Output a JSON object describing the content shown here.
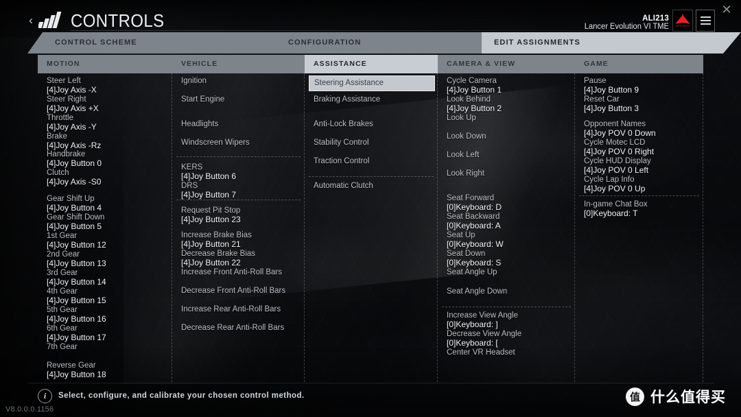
{
  "window": {
    "close_label": "✕"
  },
  "header": {
    "back_label": "‹",
    "title": "CONTROLS",
    "user_id": "ALI213",
    "user_car": "Lancer Evolution VI TME",
    "brand_text": "MITSUBISHI"
  },
  "tabs": [
    {
      "label": "CONTROL SCHEME",
      "selected": false
    },
    {
      "label": "CONFIGURATION",
      "selected": false
    },
    {
      "label": "EDIT ASSIGNMENTS",
      "selected": true
    }
  ],
  "columns": [
    {
      "header": "MOTION",
      "selected": false,
      "entries": [
        {
          "label": "Steer Left",
          "bind": "[4]Joy Axis -X"
        },
        {
          "label": "Steer Right",
          "bind": "[4]Joy Axis +X"
        },
        {
          "label": "Throttle",
          "bind": "[4]Joy Axis -Y"
        },
        {
          "label": "Brake",
          "bind": "[4]Joy Axis -Rz"
        },
        {
          "label": "Handbrake",
          "bind": "[4]Joy Button 0"
        },
        {
          "label": "Clutch",
          "bind": "[4]Joy Axis -S0"
        },
        {
          "label": "Gear Shift Up",
          "bind": "[4]Joy Button 4"
        },
        {
          "label": "Gear Shift Down",
          "bind": "[4]Joy Button 5"
        },
        {
          "label": "1st Gear",
          "bind": "[4]Joy Button 12"
        },
        {
          "label": "2nd Gear",
          "bind": "[4]Joy Button 13"
        },
        {
          "label": "3rd Gear",
          "bind": "[4]Joy Button 14"
        },
        {
          "label": "4th Gear",
          "bind": "[4]Joy Button 15"
        },
        {
          "label": "5th Gear",
          "bind": "[4]Joy Button 16"
        },
        {
          "label": "6th Gear",
          "bind": "[4]Joy Button 17"
        },
        {
          "label": "7th Gear",
          "bind": ""
        },
        {
          "label": "Reverse Gear",
          "bind": "[4]Joy Button 18"
        }
      ]
    },
    {
      "header": "VEHICLE",
      "selected": false,
      "entries": [
        {
          "label": "Ignition",
          "bind": ""
        },
        {
          "label": "Start Engine",
          "bind": ""
        },
        {
          "label": "Headlights",
          "bind": ""
        },
        {
          "label": "Windscreen Wipers",
          "bind": ""
        },
        {
          "label": "KERS",
          "bind": "[4]Joy Button 6"
        },
        {
          "label": "DRS",
          "bind": "[4]Joy Button 7"
        },
        {
          "label": "Request Pit Stop",
          "bind": "[4]Joy Button 23"
        },
        {
          "label": "Increase Brake Bias",
          "bind": "[4]Joy Button 21"
        },
        {
          "label": "Decrease Brake Bias",
          "bind": "[4]Joy Button 22"
        },
        {
          "label": "Increase Front Anti-Roll Bars",
          "bind": ""
        },
        {
          "label": "Decrease Front Anti-Roll Bars",
          "bind": ""
        },
        {
          "label": "Increase Rear Anti-Roll Bars",
          "bind": ""
        },
        {
          "label": "Decrease Rear Anti-Roll Bars",
          "bind": ""
        }
      ]
    },
    {
      "header": "ASSISTANCE",
      "selected": true,
      "entries": [
        {
          "label": "Steering Assistance",
          "bind": "",
          "selected": true
        },
        {
          "label": "Braking Assistance",
          "bind": ""
        },
        {
          "label": "Anti-Lock Brakes",
          "bind": ""
        },
        {
          "label": "Stability Control",
          "bind": ""
        },
        {
          "label": "Traction Control",
          "bind": ""
        },
        {
          "label": "Automatic Clutch",
          "bind": ""
        }
      ]
    },
    {
      "header": "CAMERA & VIEW",
      "selected": false,
      "entries": [
        {
          "label": "Cycle Camera",
          "bind": "[4]Joy Button 1"
        },
        {
          "label": "Look Behind",
          "bind": "[4]Joy Button 2"
        },
        {
          "label": "Look Up",
          "bind": ""
        },
        {
          "label": "Look Down",
          "bind": ""
        },
        {
          "label": "Look Left",
          "bind": ""
        },
        {
          "label": "Look Right",
          "bind": ""
        },
        {
          "label": "Seat Forward",
          "bind": "[0]Keyboard: D"
        },
        {
          "label": "Seat Backward",
          "bind": "[0]Keyboard: A"
        },
        {
          "label": "Seat Up",
          "bind": "[0]Keyboard: W"
        },
        {
          "label": "Seat Down",
          "bind": "[0]Keyboard: S"
        },
        {
          "label": "Seat Angle Up",
          "bind": ""
        },
        {
          "label": "Seat Angle Down",
          "bind": ""
        },
        {
          "label": "Increase View Angle",
          "bind": "[0]Keyboard: ]"
        },
        {
          "label": "Decrease View Angle",
          "bind": "[0]Keyboard: ["
        },
        {
          "label": "Center VR Headset",
          "bind": ""
        }
      ]
    },
    {
      "header": "GAME",
      "selected": false,
      "entries": [
        {
          "label": "Pause",
          "bind": "[4]Joy Button 9"
        },
        {
          "label": "Reset Car",
          "bind": "[4]Joy Button 3"
        },
        {
          "label": "Opponent Names",
          "bind": "[4]Joy POV 0 Down"
        },
        {
          "label": "Cycle Motec LCD",
          "bind": "[4]Joy POV 0 Right"
        },
        {
          "label": "Cycle HUD Display",
          "bind": "[4]Joy POV 0 Left"
        },
        {
          "label": "Cycle Lap Info",
          "bind": "[4]Joy POV 0 Up"
        },
        {
          "label": "In-game Chat Box",
          "bind": "[0]Keyboard: T"
        }
      ]
    }
  ],
  "footer": {
    "info_glyph": "i",
    "hint": "Select, configure, and calibrate your chosen control method.",
    "version": "V8.0.0.0.1156"
  },
  "watermark": {
    "mark": "值",
    "text": "什么值得买"
  }
}
